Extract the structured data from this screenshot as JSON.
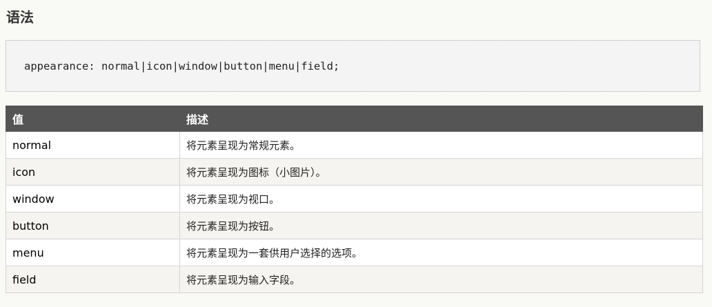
{
  "heading": "语法",
  "syntax": "appearance: normal|icon|window|button|menu|field;",
  "table": {
    "headers": [
      "值",
      "描述"
    ],
    "rows": [
      {
        "value": "normal",
        "desc": "将元素呈现为常规元素。"
      },
      {
        "value": "icon",
        "desc": "将元素呈现为图标（小图片）。"
      },
      {
        "value": "window",
        "desc": "将元素呈现为视口。"
      },
      {
        "value": "button",
        "desc": "将元素呈现为按钮。"
      },
      {
        "value": "menu",
        "desc": "将元素呈现为一套供用户选择的选项。"
      },
      {
        "value": "field",
        "desc": "将元素呈现为输入字段。"
      }
    ]
  }
}
